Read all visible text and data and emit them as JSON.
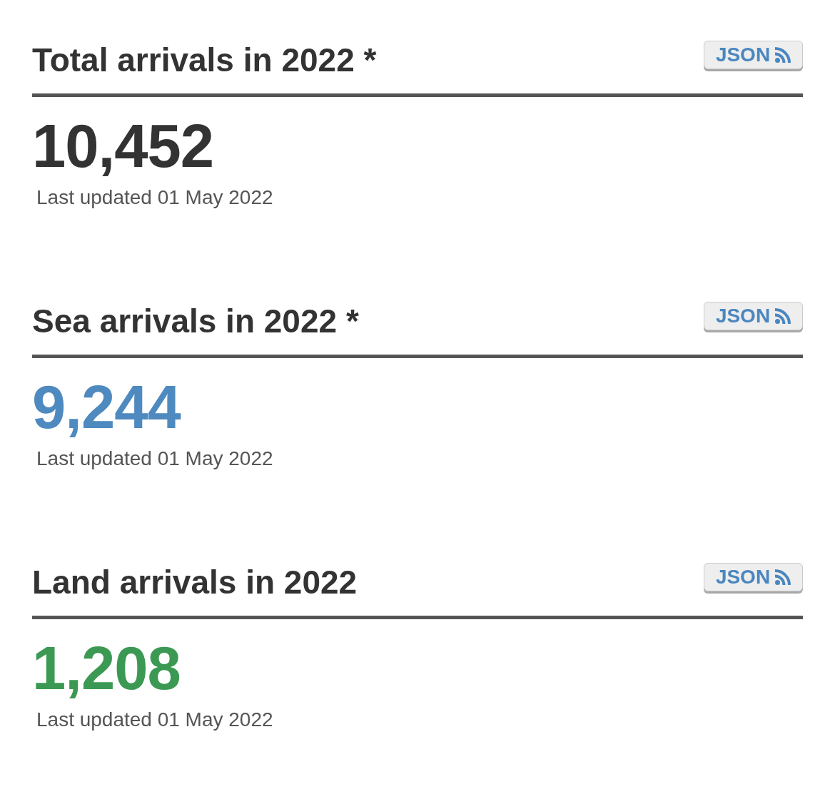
{
  "sections": [
    {
      "title": "Total arrivals in 2022 *",
      "button": "JSON",
      "value": "10,452",
      "color": "#333333",
      "updated": "Last updated 01 May 2022"
    },
    {
      "title": "Sea arrivals in 2022 *",
      "button": "JSON",
      "value": "9,244",
      "color": "#4e8abf",
      "updated": "Last updated 01 May 2022"
    },
    {
      "title": "Land arrivals in 2022",
      "button": "JSON",
      "value": "1,208",
      "color": "#3c9953",
      "updated": "Last updated 01 May 2022"
    }
  ]
}
